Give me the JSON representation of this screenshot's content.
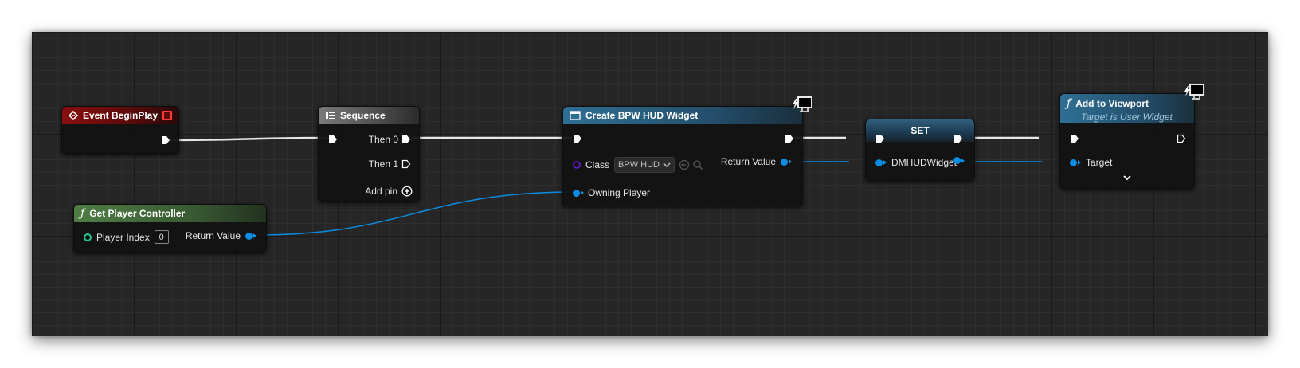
{
  "nodes": {
    "event_begin_play": {
      "title": "Event BeginPlay"
    },
    "sequence": {
      "title": "Sequence",
      "then0": "Then 0",
      "then1": "Then 1",
      "add_pin": "Add pin"
    },
    "get_player_controller": {
      "title": "Get Player Controller",
      "player_index_label": "Player Index",
      "player_index_value": "0",
      "return_value": "Return Value"
    },
    "create_widget": {
      "title": "Create BPW HUD Widget",
      "class_label": "Class",
      "class_value": "BPW HUD",
      "return_value": "Return Value",
      "owning_player": "Owning Player"
    },
    "set": {
      "title": "SET",
      "variable": "DMHUDWidget"
    },
    "add_to_viewport": {
      "title": "Add to Viewport",
      "subtitle": "Target is User Widget",
      "target": "Target"
    }
  },
  "colors": {
    "exec": "#ffffff",
    "object_pin": "#0b8de3",
    "int_pin": "#1cc98a",
    "class_pin": "#5a1ab8",
    "event_header": "#8a0f10",
    "pure_header": "#4f7d44",
    "function_header": "#2f6f94"
  },
  "icons": {
    "event": "event-diamond-icon",
    "sequence": "sequence-icon",
    "function": "function-f-icon",
    "widget": "widget-window-icon",
    "server_client": "monitor-lightning-icon"
  }
}
